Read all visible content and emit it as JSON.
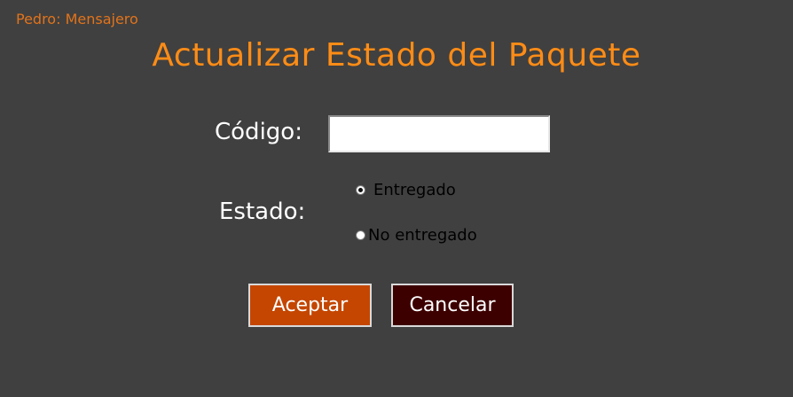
{
  "header": {
    "user": "Pedro: Mensajero",
    "title": "Actualizar Estado del Paquete"
  },
  "form": {
    "codigo_label": "Código:",
    "codigo_value": "",
    "estado_label": "Estado:",
    "estado_options": [
      {
        "label": "Entregado",
        "checked": true
      },
      {
        "label": "No entregado",
        "checked": false
      }
    ]
  },
  "buttons": {
    "accept_label": "Aceptar",
    "cancel_label": "Cancelar"
  },
  "colors": {
    "background": "#404040",
    "title": "#ff8c16",
    "user_label": "#e2731a",
    "accept_button": "#c44600",
    "cancel_button": "#3d0000"
  }
}
